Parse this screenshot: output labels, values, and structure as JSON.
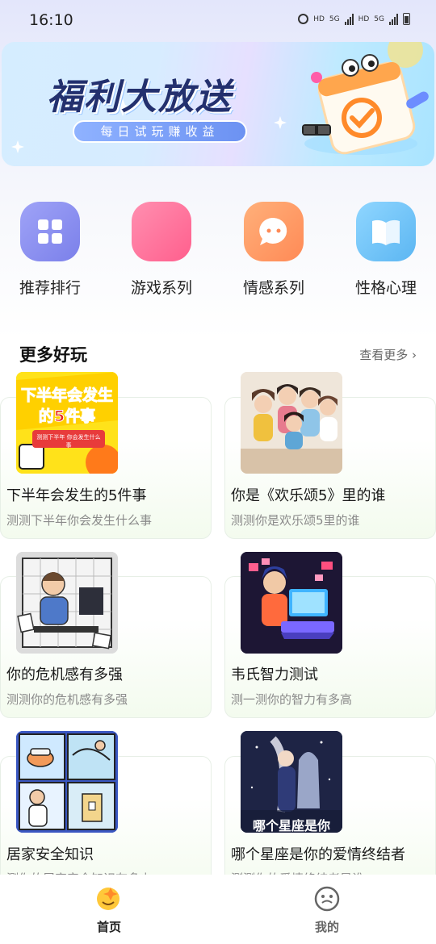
{
  "status": {
    "time": "16:10",
    "net1": "HD",
    "net1_type": "5G",
    "net2": "HD",
    "net2_type": "5G"
  },
  "banner": {
    "title": "福利大放送",
    "subtitle": "每日试玩赚收益"
  },
  "categories": [
    {
      "label": "推荐排行",
      "icon": "grid-icon",
      "color": "#8a90f2"
    },
    {
      "label": "游戏系列",
      "icon": "gamepad-icon",
      "color": "#ff6f97"
    },
    {
      "label": "情感系列",
      "icon": "chat-bubble-icon",
      "color": "#ff9a63"
    },
    {
      "label": "性格心理",
      "icon": "book-icon",
      "color": "#6cc2f5"
    }
  ],
  "section": {
    "title": "更多好玩",
    "more": "查看更多"
  },
  "cards": [
    {
      "title": "下半年会发生的5件事",
      "desc": "测测下半年你会发生什么事",
      "thumb_text": "下半年会发生的5件事",
      "thumb_sub": "测测下半年 你会发生什么事"
    },
    {
      "title": "你是《欢乐颂5》里的谁",
      "desc": "测测你是欢乐颂5里的谁"
    },
    {
      "title": "你的危机感有多强",
      "desc": "测测你的危机感有多强"
    },
    {
      "title": "韦氏智力测试",
      "desc": "测一测你的智力有多高"
    },
    {
      "title": "居家安全知识",
      "desc": "测你的居家安全知识有多少"
    },
    {
      "title": "哪个星座是你的爱情终结者",
      "desc": "测测你的爱情终结者是谁",
      "thumb_text": "哪个星座是你"
    }
  ],
  "nav": {
    "home": "首页",
    "mine": "我的",
    "active_color": "#222222",
    "inactive_color": "#666666"
  }
}
